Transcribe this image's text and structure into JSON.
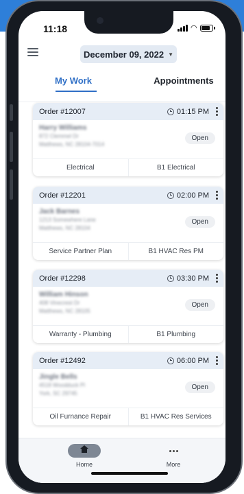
{
  "status_bar": {
    "time": "11:18"
  },
  "header": {
    "date": "December 09, 2022"
  },
  "tabs": [
    {
      "label": "My Work",
      "active": true
    },
    {
      "label": "Appointments",
      "active": false
    }
  ],
  "orders": [
    {
      "order_no": "Order #12007",
      "time": "01:15 PM",
      "status": "Open",
      "customer": "Harry Williams",
      "address1": "872 Clemmel Dr",
      "address2": "Matthews, NC 28104-7014",
      "service": "Electrical",
      "division": "B1 Electrical"
    },
    {
      "order_no": "Order #12201",
      "time": "02:00 PM",
      "status": "Open",
      "customer": "Jack Barnes",
      "address1": "1213 Somewhere Lane",
      "address2": "Matthews, NC 28104",
      "service": "Service Partner Plan",
      "division": "B1 HVAC Res PM"
    },
    {
      "order_no": "Order #12298",
      "time": "03:30 PM",
      "status": "Open",
      "customer": "William Hinson",
      "address1": "408 Vinecrest Dr",
      "address2": "Matthews, NC 28105",
      "service": "Warranty - Plumbing",
      "division": "B1 Plumbing"
    },
    {
      "order_no": "Order #12492",
      "time": "06:00 PM",
      "status": "Open",
      "customer": "Jingle Bells",
      "address1": "4518 Woodduck Pl",
      "address2": "York, SC 29745",
      "service": "Oil Furnance Repair",
      "division": "B1 HVAC Res Services"
    }
  ],
  "bottom_nav": {
    "home": "Home",
    "more": "More"
  },
  "colors": {
    "accent": "#2f6fc6",
    "background_band": "#2e7fd9",
    "card_header": "#e6edf6"
  }
}
